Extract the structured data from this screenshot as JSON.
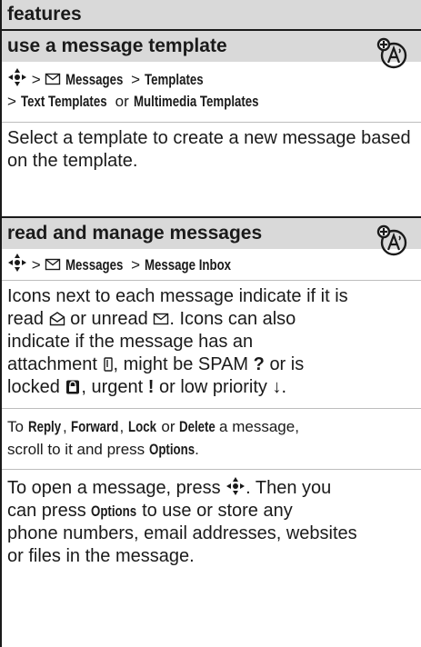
{
  "header": {
    "title": "features"
  },
  "sections": [
    {
      "title": "use a message template",
      "icon": "network-feature-icon",
      "path_line1": {
        "sep1": ">",
        "messages": "Messages",
        "sep2": ">",
        "templates": "Templates"
      },
      "path_line2": {
        "sep1": ">",
        "text_templates": "Text Templates",
        "or": "or",
        "mm_templates": "Multimedia Templates"
      },
      "description": "Select a template to create a new message based on the template."
    },
    {
      "title": "read and manage messages",
      "icon": "network-feature-icon",
      "path_line1": {
        "sep1": ">",
        "messages": "Messages",
        "sep2": ">",
        "inbox": "Message Inbox"
      },
      "para1": {
        "t1": "Icons next to each message indicate if it is",
        "t2a": "read",
        "t2b": "or unread",
        "t2c": ". Icons can also",
        "t3": "indicate if the message has an",
        "t4a": "attachment",
        "t4b": ", might be SPAM",
        "spam_glyph": "?",
        "t4c": "or is",
        "t5a": "locked",
        "t5b": ", urgent",
        "urgent_glyph": "!",
        "t5c": "or low priority",
        "low_glyph": "↓",
        "t5d": "."
      },
      "para2": {
        "a": "To",
        "reply": "Reply",
        "c1": ",",
        "forward": "Forward",
        "c2": ",",
        "lock": "Lock",
        "or": "or",
        "delete": "Delete",
        "b": "a message,",
        "line2a": "scroll to it and press",
        "options": "Options",
        "dot": "."
      },
      "para3": {
        "a": "To open a message, press",
        "b": ". Then you",
        "l2a": "can press",
        "options": "Options",
        "l2b": "to use or store any",
        "l3": "phone numbers, email addresses, websites",
        "l4": "or files in the message."
      }
    }
  ]
}
